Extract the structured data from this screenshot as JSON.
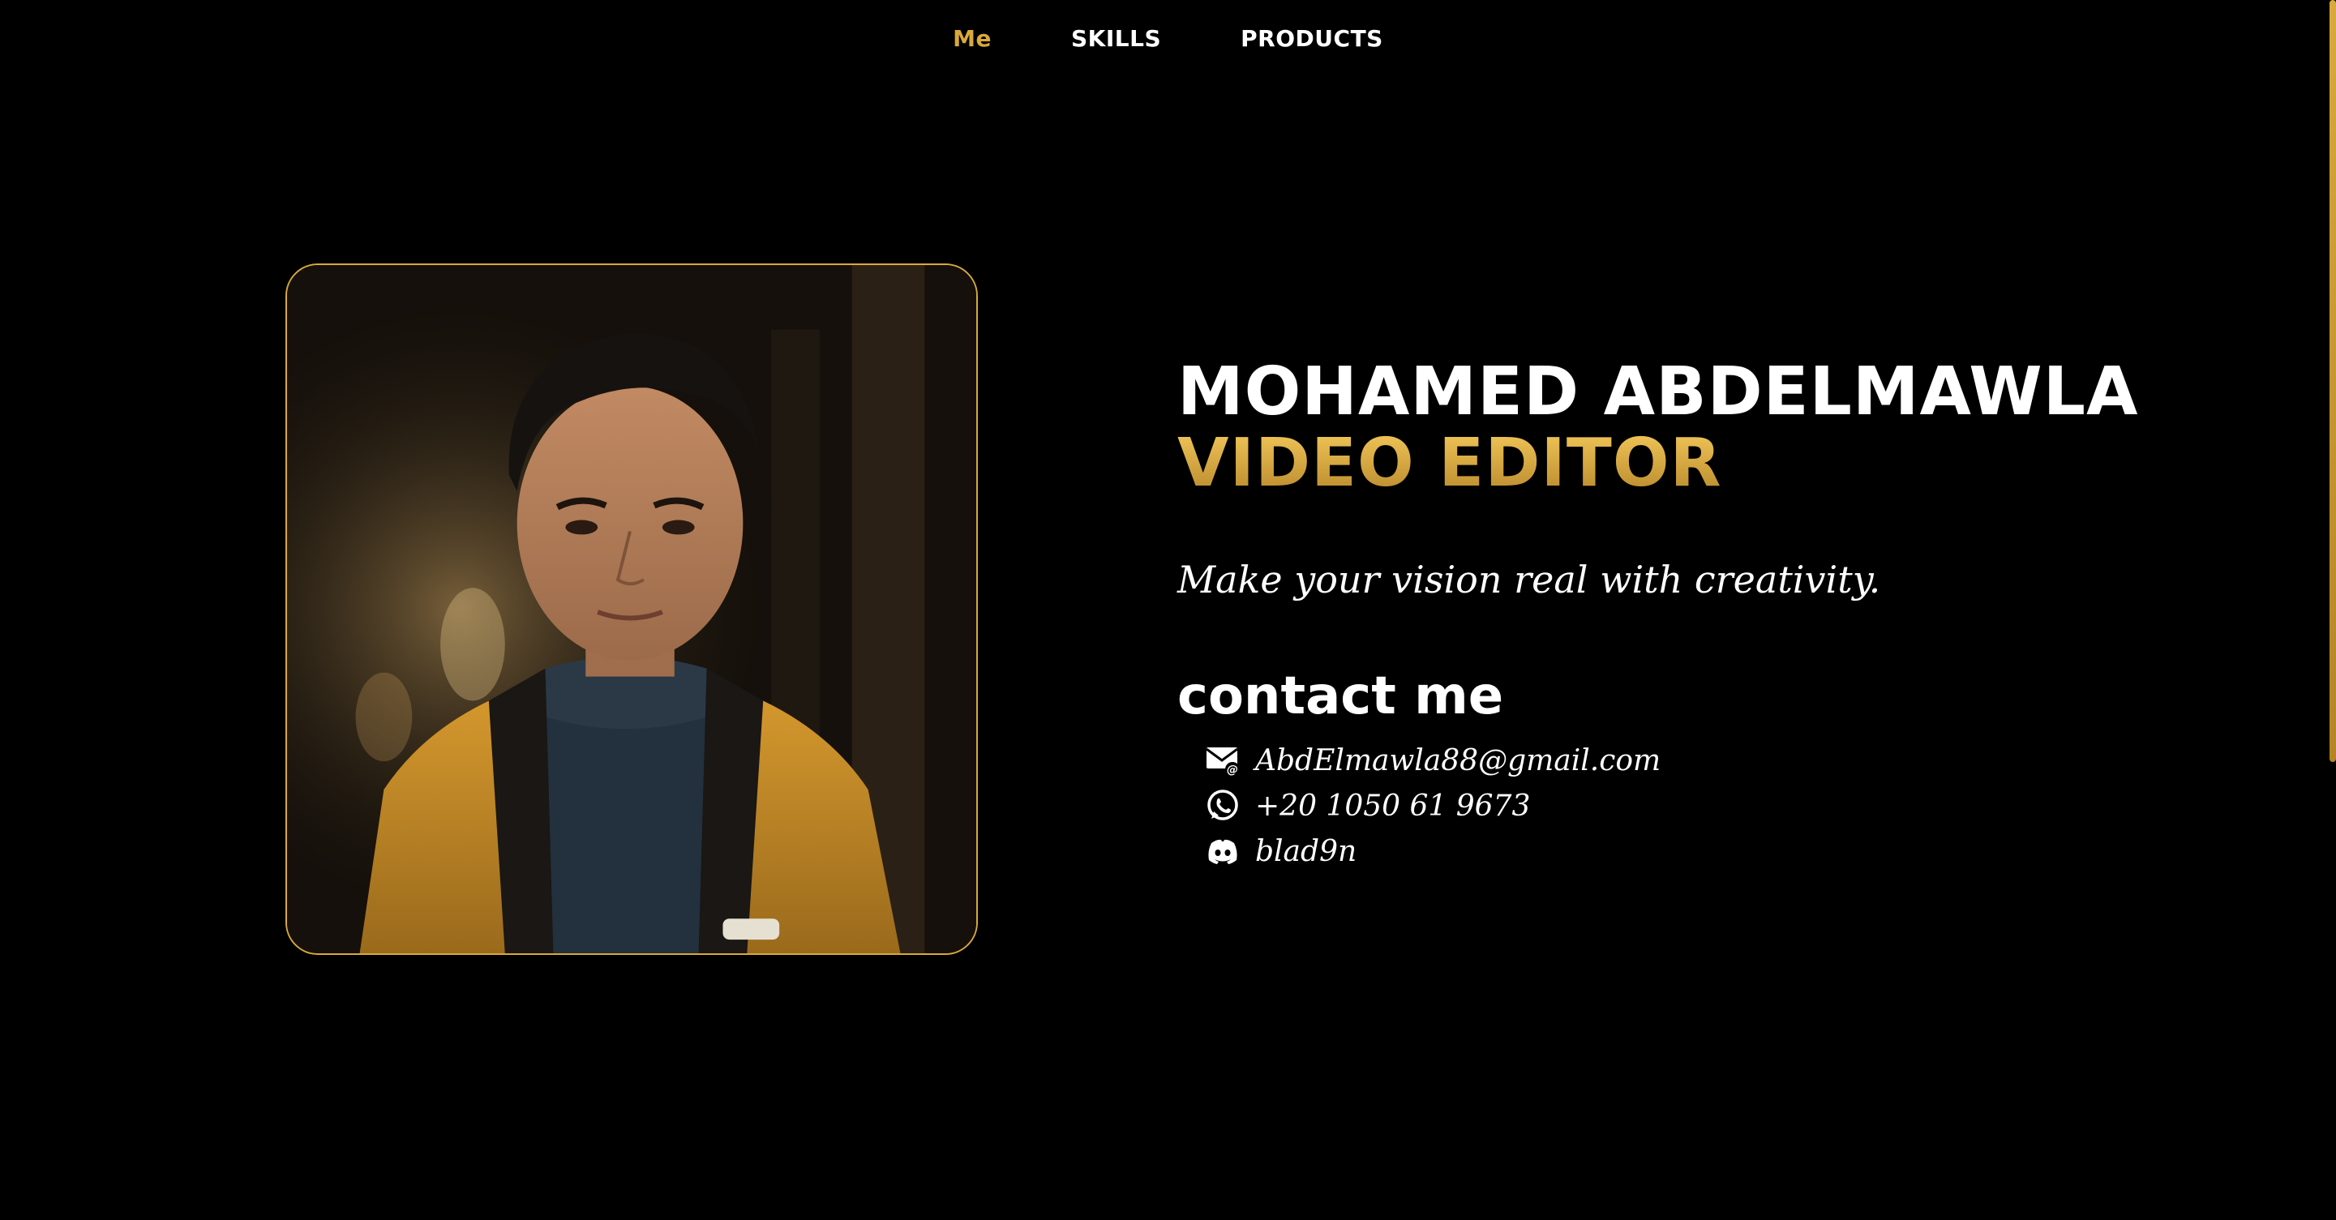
{
  "nav": {
    "items": [
      {
        "label": "Me",
        "active": true
      },
      {
        "label": "SKILLS",
        "active": false
      },
      {
        "label": "PRODUCTS",
        "active": false
      }
    ]
  },
  "hero": {
    "name": "MOHAMED ABDELMAWLA",
    "role": "VIDEO EDITOR",
    "tagline": "Make your vision real with creativity."
  },
  "contact": {
    "heading": "contact me",
    "items": [
      {
        "icon": "email-icon",
        "text": "AbdElmawla88@gmail.com"
      },
      {
        "icon": "whatsapp-icon",
        "text": "+20 1050 61 9673"
      },
      {
        "icon": "discord-icon",
        "text": "blad9n"
      }
    ]
  },
  "colors": {
    "background": "#000000",
    "accent": "#d9a93a",
    "text": "#ffffff"
  }
}
